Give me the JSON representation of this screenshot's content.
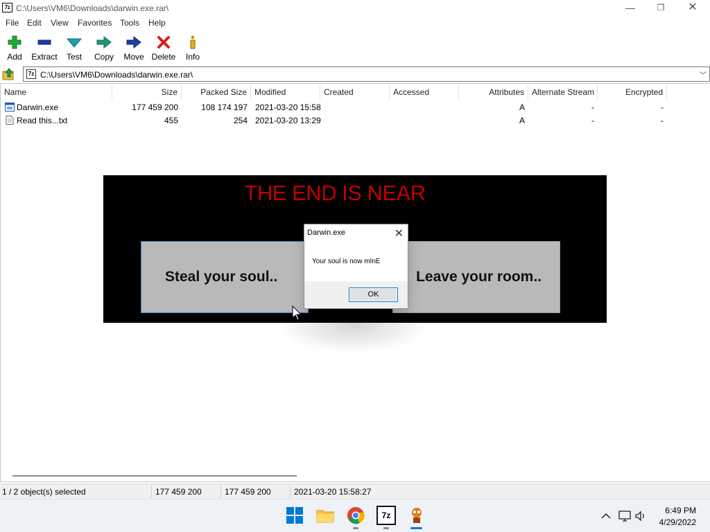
{
  "window": {
    "title": "C:\\Users\\VM6\\Downloads\\darwin.exe.rar\\",
    "icon_text": "7z"
  },
  "menu": [
    "File",
    "Edit",
    "View",
    "Favorites",
    "Tools",
    "Help"
  ],
  "toolbar": {
    "add": "Add",
    "extract": "Extract",
    "test": "Test",
    "copy": "Copy",
    "move": "Move",
    "delete": "Delete",
    "info": "Info"
  },
  "address": {
    "path": "C:\\Users\\VM6\\Downloads\\darwin.exe.rar\\"
  },
  "columns": [
    "Name",
    "Size",
    "Packed Size",
    "Modified",
    "Created",
    "Accessed",
    "Attributes",
    "Alternate Stream",
    "Encrypted"
  ],
  "files": [
    {
      "name": "Darwin.exe",
      "size": "177 459 200",
      "packed": "108 174 197",
      "modified": "2021-03-20 15:58",
      "created": "",
      "accessed": "",
      "attributes": "A",
      "alt_stream": "-",
      "encrypted": "-"
    },
    {
      "name": "Read this...txt",
      "size": "455",
      "packed": "254",
      "modified": "2021-03-20 13:29",
      "created": "",
      "accessed": "",
      "attributes": "A",
      "alt_stream": "-",
      "encrypted": "-"
    }
  ],
  "status": {
    "selected": "1 / 2 object(s) selected",
    "size": "177 459 200",
    "packed": "177 459 200",
    "modified": "2021-03-20 15:58:27"
  },
  "scare": {
    "title": "THE END IS NEAR",
    "left_button": "Steal your soul..",
    "right_button": "Leave your room.."
  },
  "dialog": {
    "title": "Darwin.exe",
    "message": "Your soul is now mInE",
    "ok": "OK"
  },
  "clock": {
    "time": "6:49 PM",
    "date": "4/29/2022"
  },
  "taskbar": {
    "sevenzip_text": "7z"
  },
  "colors": {
    "scare_title": "#c00000",
    "windows_blue": "#0078d7",
    "toolbar_add": "#22a832",
    "toolbar_delete": "#d32020",
    "toolbar_move": "#1f3fa0"
  }
}
